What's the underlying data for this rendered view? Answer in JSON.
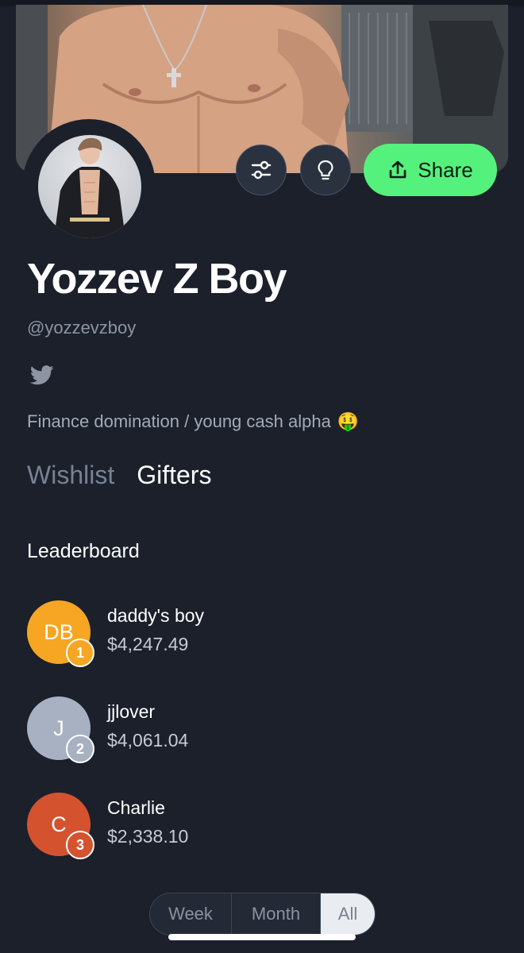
{
  "profile": {
    "name": "Yozzev Z Boy",
    "handle": "@yozzevzboy",
    "bio": "Finance domination / young cash alpha",
    "bio_emoji": "🤑",
    "social_icon": "twitter-icon"
  },
  "actions": {
    "filter_icon": "sliders-icon",
    "idea_icon": "lightbulb-icon",
    "share_label": "Share",
    "share_icon": "share-upload-icon"
  },
  "tabs": [
    {
      "label": "Wishlist",
      "active": false
    },
    {
      "label": "Gifters",
      "active": true
    }
  ],
  "leaderboard": {
    "title": "Leaderboard",
    "entries": [
      {
        "initials": "DB",
        "name": "daddy's boy",
        "amount": "$4,247.49",
        "rank": "1",
        "color": "#f6a623"
      },
      {
        "initials": "J",
        "name": "jjlover",
        "amount": "$4,061.04",
        "rank": "2",
        "color": "#a7b1c2"
      },
      {
        "initials": "C",
        "name": "Charlie",
        "amount": "$2,338.10",
        "rank": "3",
        "color": "#d4532e"
      }
    ]
  },
  "period_filter": {
    "options": [
      "Week",
      "Month",
      "All"
    ],
    "selected": "All"
  },
  "colors": {
    "background": "#1b202b",
    "accent": "#54f27c",
    "muted_text": "#8d94a3"
  }
}
